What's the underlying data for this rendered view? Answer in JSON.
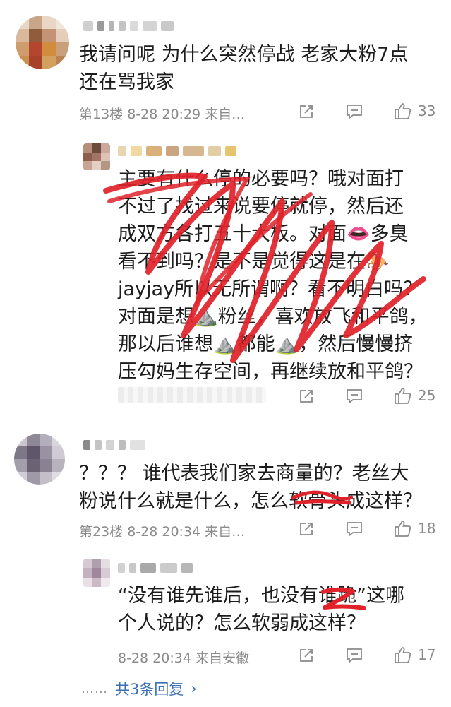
{
  "comments": [
    {
      "text": "我请问呢 为什么突然停战  老家大粉7点\n还在骂我家",
      "meta": "第13楼 8-28 20:29 来自…",
      "likes": "33"
    },
    {
      "text": "主要有什么停的必要吗？哦对面打\n不过了找过来说要停就停，然后还\n成双方各打五十大板。对面👄多臭\n看不到吗？是不是觉得这是在🐎\njayjay所以无所谓啊？看不明白吗？\n对面是想⛰️粉丝，喜欢放飞和平鸽，\n那以后谁想⛰️都能⛰️，然后慢慢挤\n压勾妈生存空间，再继续放和平鸽？",
      "likes": "25"
    },
    {
      "text": "？？？ 谁代表我们家去商量的？老丝大\n粉说什么就是什么，怎么软骨头成这样？",
      "meta": "第23楼 8-28 20:34 来自…",
      "likes": "18"
    },
    {
      "text": "“没有谁先谁后，也没有谁跪”这哪\n个人说的？怎么软弱成这样？",
      "meta": "8-28 20:34 来自安徽",
      "likes": "17"
    }
  ],
  "more_replies": {
    "dots": "……",
    "label": "共3条回复",
    "chevron": "›"
  },
  "icons": [
    "share-icon",
    "comment-icon",
    "like-icon"
  ],
  "colors": {
    "scribble": "#e0222a",
    "link": "#3a6fb8",
    "meta": "#8a8a8a"
  }
}
